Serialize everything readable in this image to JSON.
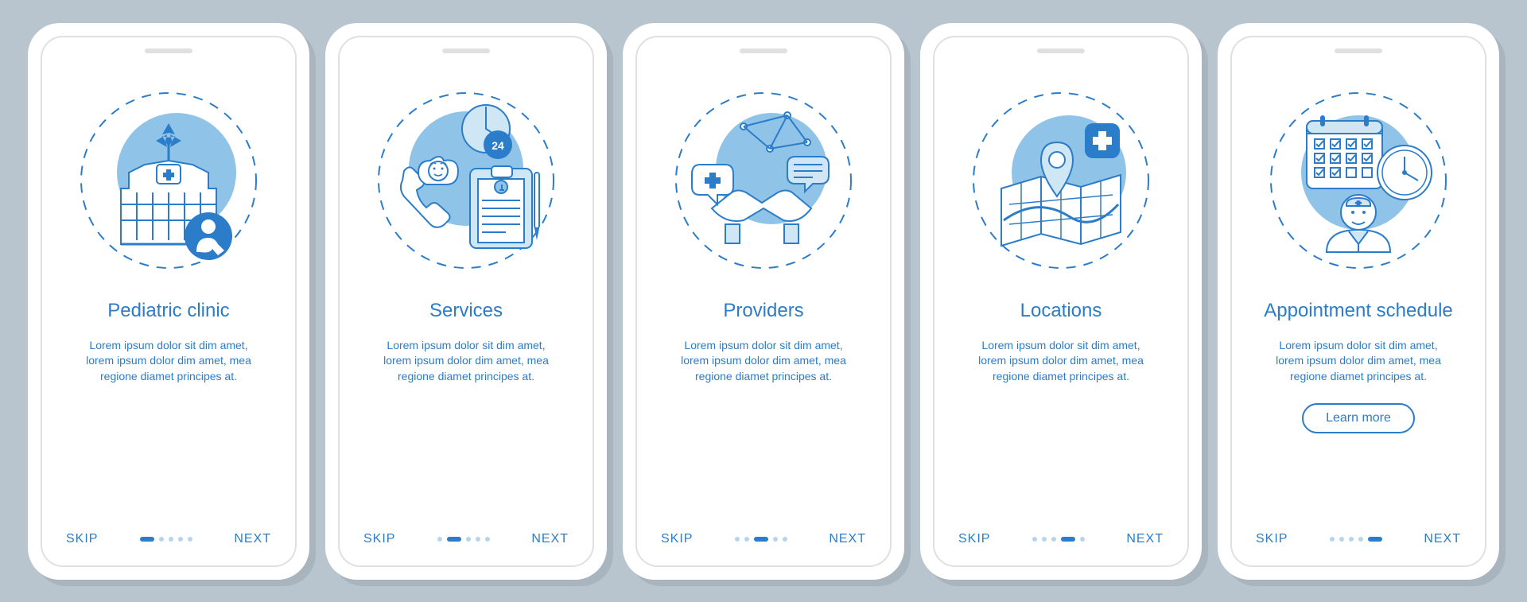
{
  "colors": {
    "primary": "#2b7cc9",
    "light": "#8fc4e8",
    "pale": "#cfe6f5",
    "bg": "#b8c5cf"
  },
  "common": {
    "skip": "SKIP",
    "next": "NEXT",
    "learn_more": "Learn more",
    "desc": "Lorem ipsum dolor sit dim amet, lorem ipsum dolor dim amet, mea regione diamet principes at."
  },
  "screens": [
    {
      "title": "Pediatric clinic",
      "icon": "clinic",
      "active": 0,
      "cta": false
    },
    {
      "title": "Services",
      "icon": "services",
      "active": 1,
      "cta": false
    },
    {
      "title": "Providers",
      "icon": "providers",
      "active": 2,
      "cta": false
    },
    {
      "title": "Locations",
      "icon": "locations",
      "active": 3,
      "cta": false
    },
    {
      "title": "Appointment schedule",
      "icon": "appointment",
      "active": 4,
      "cta": true
    }
  ],
  "dot_count": 5
}
